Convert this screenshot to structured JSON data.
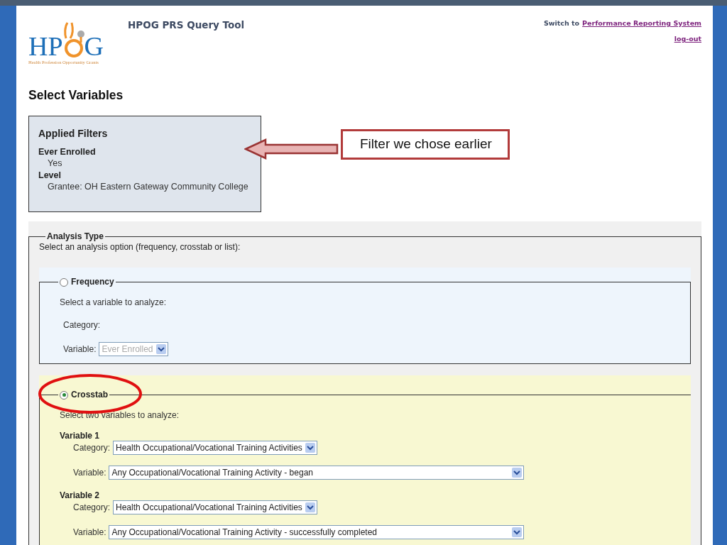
{
  "header": {
    "logo_left": "HP",
    "logo_right": "G",
    "logo_tagline": "Health Profession Opportunity Grants",
    "title": "HPOG PRS Query Tool",
    "switch_text": "Switch to",
    "switch_link": "Performance Reporting System",
    "logout": "log-out"
  },
  "heading": "Select Variables",
  "applied_filters": {
    "title": "Applied Filters",
    "filters": [
      {
        "name": "Ever Enrolled",
        "value": "Yes"
      },
      {
        "name": "Level",
        "value": "Grantee: OH Eastern Gateway Community College"
      }
    ]
  },
  "callout": {
    "text": "Filter we chose earlier"
  },
  "analysis": {
    "legend": "Analysis Type",
    "instruction": "Select an analysis option (frequency, crosstab or list):",
    "options": [
      {
        "kind": "frequency",
        "label": "Frequency",
        "selected": false,
        "circled": false,
        "instruction": "Select a variable to analyze:",
        "category_label": "Category:",
        "variable_label": "Variable:",
        "variable_value": "Ever Enrolled",
        "disabled": true
      },
      {
        "kind": "crosstab",
        "label": "Crosstab",
        "selected": true,
        "circled": true,
        "instruction": "Select two variables to analyze:",
        "variables": [
          {
            "title": "Variable 1",
            "category_label": "Category:",
            "category_value": "Health Occupational/Vocational Training Activities",
            "variable_label": "Variable:",
            "variable_value": "Any Occupational/Vocational Training Activity - began"
          },
          {
            "title": "Variable 2",
            "category_label": "Category:",
            "category_value": "Health Occupational/Vocational Training Activities",
            "variable_label": "Variable:",
            "variable_value": "Any Occupational/Vocational Training Activity - successfully completed"
          }
        ]
      }
    ]
  }
}
